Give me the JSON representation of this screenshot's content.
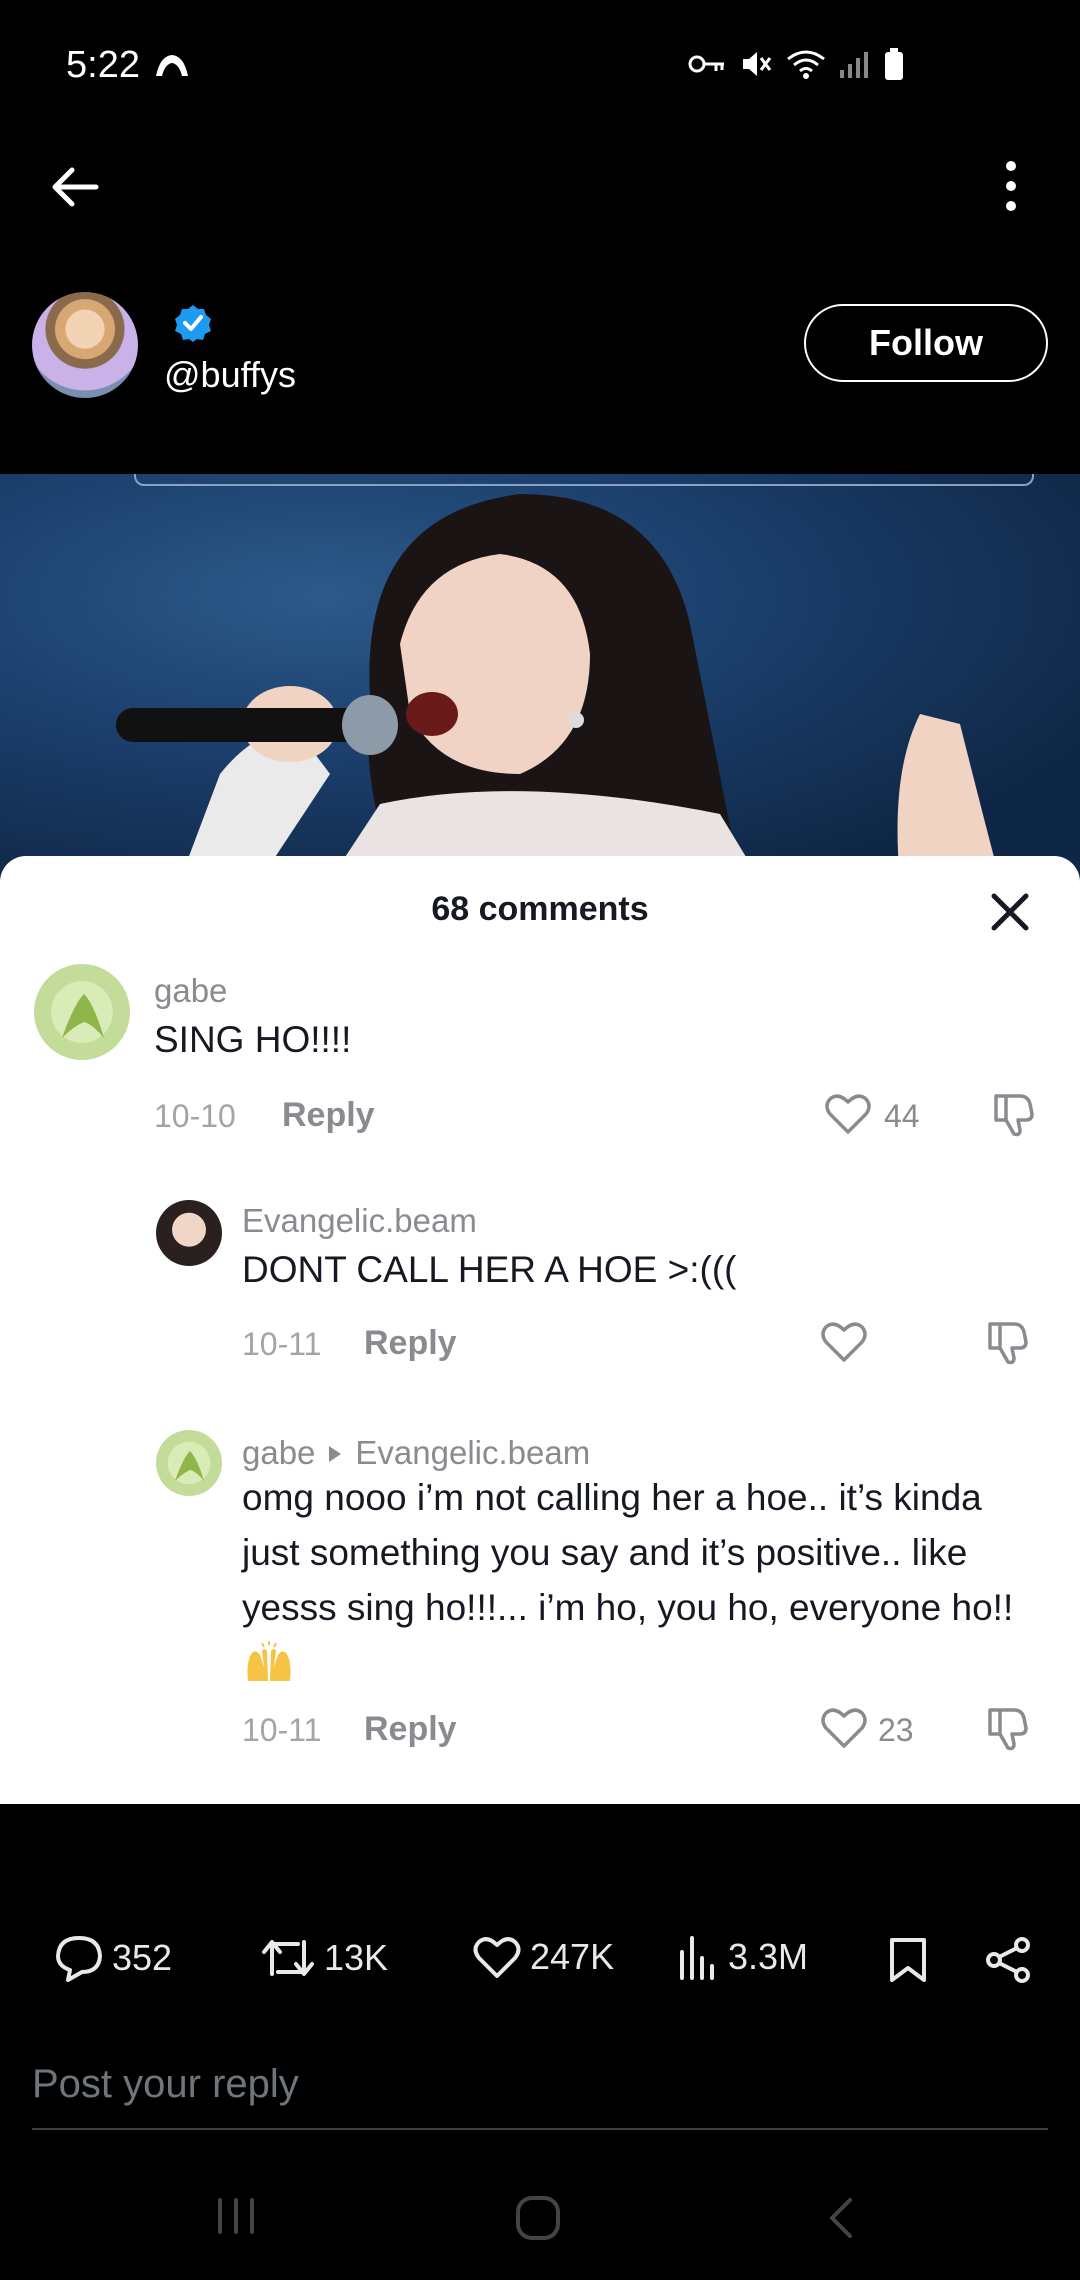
{
  "status_bar": {
    "time": "5:22"
  },
  "author": {
    "handle": "@buffys",
    "verified": true,
    "follow_label": "Follow"
  },
  "comments_sheet": {
    "title": "68 comments",
    "comments": [
      {
        "user": "gabe",
        "text": "SING HO!!!!",
        "date": "10-10",
        "reply_label": "Reply",
        "likes": "44"
      },
      {
        "user": "Evangelic.beam",
        "text": "DONT CALL HER A HOE >:(((",
        "date": "10-11",
        "reply_label": "Reply",
        "likes": ""
      },
      {
        "user": "gabe",
        "reply_to": "Evangelic.beam",
        "text": "omg nooo i’m not calling her a hoe.. it’s kinda just something you say and it’s positive.. like yesss sing ho!!!... i’m ho, you ho, everyone ho!!",
        "date": "10-11",
        "reply_label": "Reply",
        "likes": "23"
      }
    ]
  },
  "actions": {
    "replies": "352",
    "reposts": "13K",
    "likes": "247K",
    "views": "3.3M"
  },
  "reply_box": {
    "placeholder": "Post your reply"
  },
  "colors": {
    "verified": "#1d9bf0",
    "background": "#000000",
    "sheet": "#ffffff"
  },
  "icons": [
    "back-arrow-icon",
    "more-vertical-icon",
    "verified-badge-icon",
    "close-icon",
    "heart-icon",
    "dislike-icon",
    "comment-icon",
    "repost-icon",
    "views-icon",
    "bookmark-icon",
    "share-icon"
  ]
}
